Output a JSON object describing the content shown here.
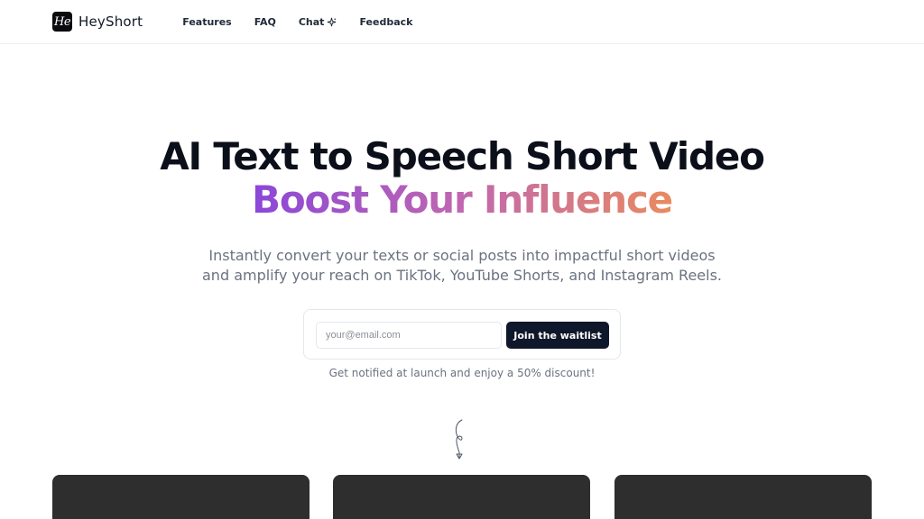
{
  "brand": {
    "logo_mark": "He",
    "name": "HeyShort"
  },
  "nav": {
    "items": [
      {
        "label": "Features"
      },
      {
        "label": "FAQ"
      },
      {
        "label": "Chat",
        "icon": "sparkle-icon"
      },
      {
        "label": "Feedback"
      }
    ]
  },
  "hero": {
    "title": "AI Text to Speech Short Video",
    "subtitle": "Boost Your Influence",
    "description_line1": "Instantly convert your texts or social posts into impactful short videos",
    "description_line2": "and amplify your reach on TikTok, YouTube Shorts, and Instagram Reels."
  },
  "waitlist": {
    "email_placeholder": "your@email.com",
    "email_value": "",
    "button_label": "Join the waitlist",
    "notice": "Get notified at launch and enjoy a 50% discount!"
  },
  "colors": {
    "gradient_start": "#8b47d8",
    "gradient_mid": "#c067b0",
    "gradient_end": "#e88a5f",
    "button_bg": "#0f172a",
    "card_bg": "#2e2e2e"
  },
  "decor": {
    "arrow": "curly-down-arrow-icon"
  }
}
